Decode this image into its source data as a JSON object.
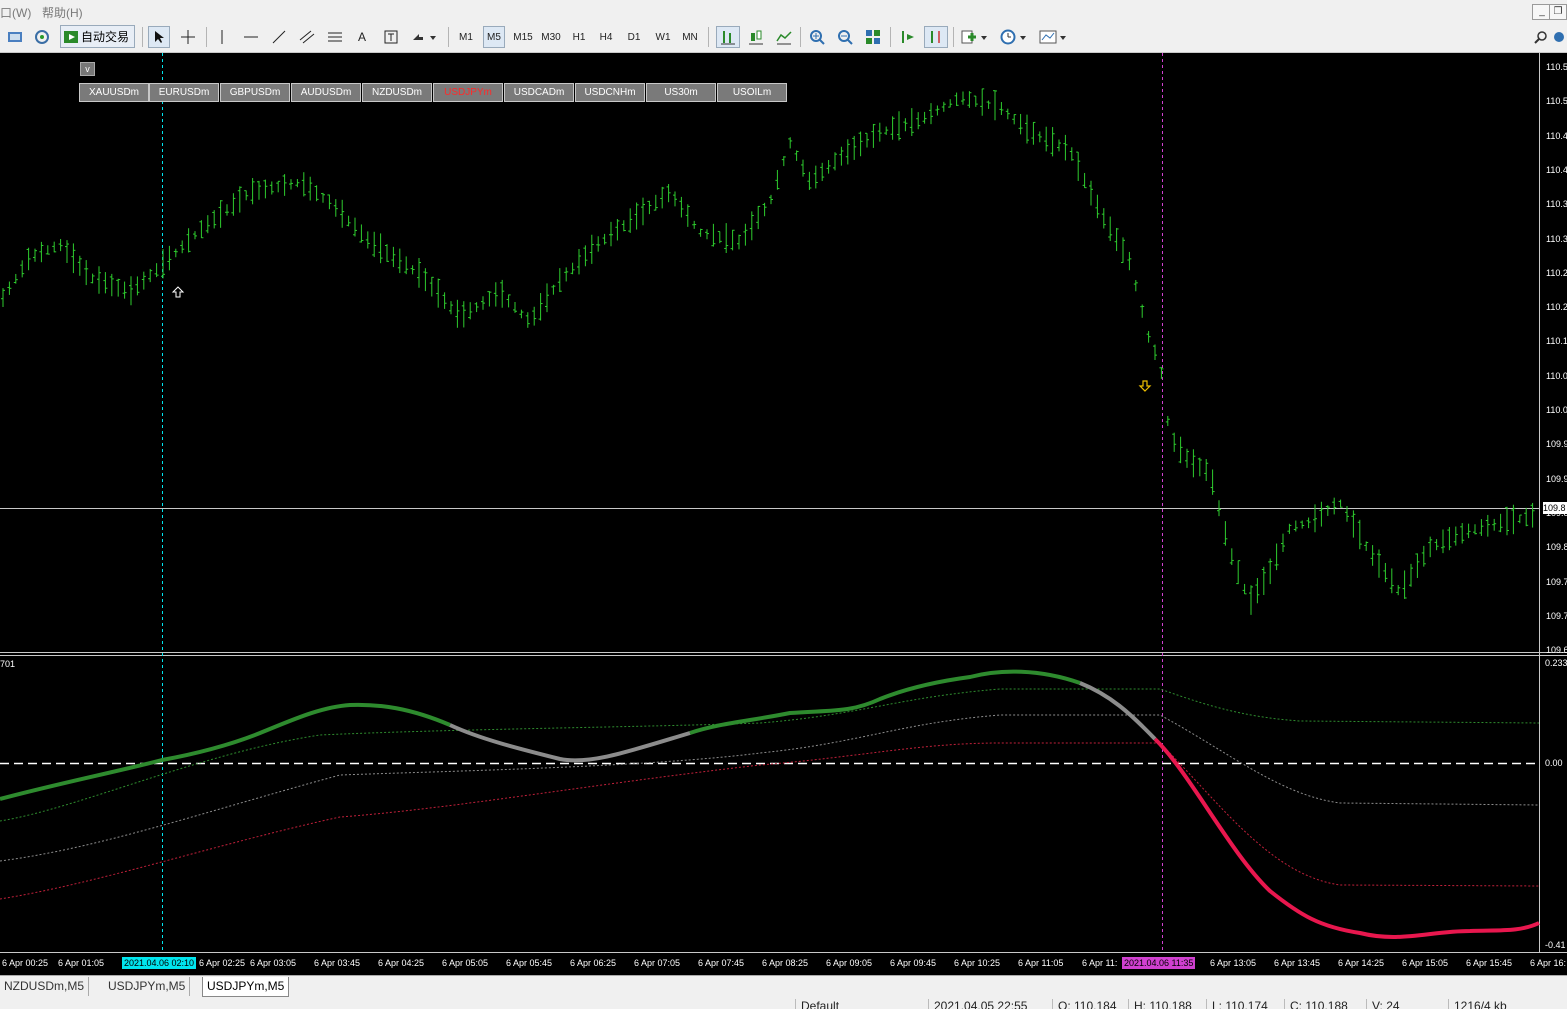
{
  "menu": {
    "window_partial": "口(W)",
    "help": "帮助(H)"
  },
  "toolbar": {
    "autotrade_label": "自动交易",
    "timeframes": [
      "M1",
      "M5",
      "M15",
      "M30",
      "H1",
      "H4",
      "D1",
      "W1",
      "MN"
    ],
    "active_timeframe": "M5",
    "text_tool": "A"
  },
  "chart": {
    "symbol": "USDJPYm",
    "timeframe": "M5",
    "v_button": "v",
    "symbol_buttons": [
      "XAUUSDm",
      "EURUSDm",
      "GBPUSDm",
      "AUDUSDm",
      "NZDUSDm",
      "USDJPYm",
      "USDCADm",
      "USDCNHm",
      "US30m",
      "USOILm"
    ],
    "active_symbol_button": "USDJPYm",
    "price_ticks": [
      "110.5",
      "110.5",
      "110.4",
      "110.4",
      "110.3",
      "110.3",
      "110.2",
      "110.2",
      "110.1",
      "110.0",
      "110.0",
      "109.9",
      "109.9",
      "109.8",
      "109.8",
      "109.7",
      "109.7",
      "109.6"
    ],
    "current_price_label": "109.8",
    "indicator_label": "701",
    "indicator_ticks": [
      "0.233",
      "0.00",
      "-0.41"
    ],
    "time_labels": [
      "6 Apr 00:25",
      "6 Apr 01:05",
      "6 Apr 02:25",
      "6 Apr 03:05",
      "6 Apr 03:45",
      "6 Apr 04:25",
      "6 Apr 05:05",
      "6 Apr 05:45",
      "6 Apr 06:25",
      "6 Apr 07:05",
      "6 Apr 07:45",
      "6 Apr 08:25",
      "6 Apr 09:05",
      "6 Apr 09:45",
      "6 Apr 10:25",
      "6 Apr 11:05",
      "6 Apr 11:",
      "6 Apr 13:05",
      "6 Apr 13:45",
      "6 Apr 14:25",
      "6 Apr 15:05",
      "6 Apr 15:45",
      "6 Apr 16:"
    ],
    "crosshair_time_1": "2021.04.06 02:10",
    "crosshair_time_2": "2021.04.06 11:35",
    "colors": {
      "background": "#000000",
      "bars": "#2ecc2e",
      "osc_up": "#2e8b2e",
      "osc_flat": "#8c8c8c",
      "osc_down": "#e8174e",
      "cursor_line_1": "#00e5ee",
      "cursor_line_2": "#d040d0"
    }
  },
  "tabs": [
    "NZDUSDm,M5",
    "USDJPYm,M5",
    "USDJPYm,M5"
  ],
  "active_tab": 2,
  "status": {
    "profile": "Default",
    "datetime": "2021.04.05 22:55",
    "open": "O: 110.184",
    "high": "H: 110.188",
    "low": "L: 110.174",
    "close": "C: 110.188",
    "volume": "V: 24",
    "traffic": "1216/4 kb"
  }
}
